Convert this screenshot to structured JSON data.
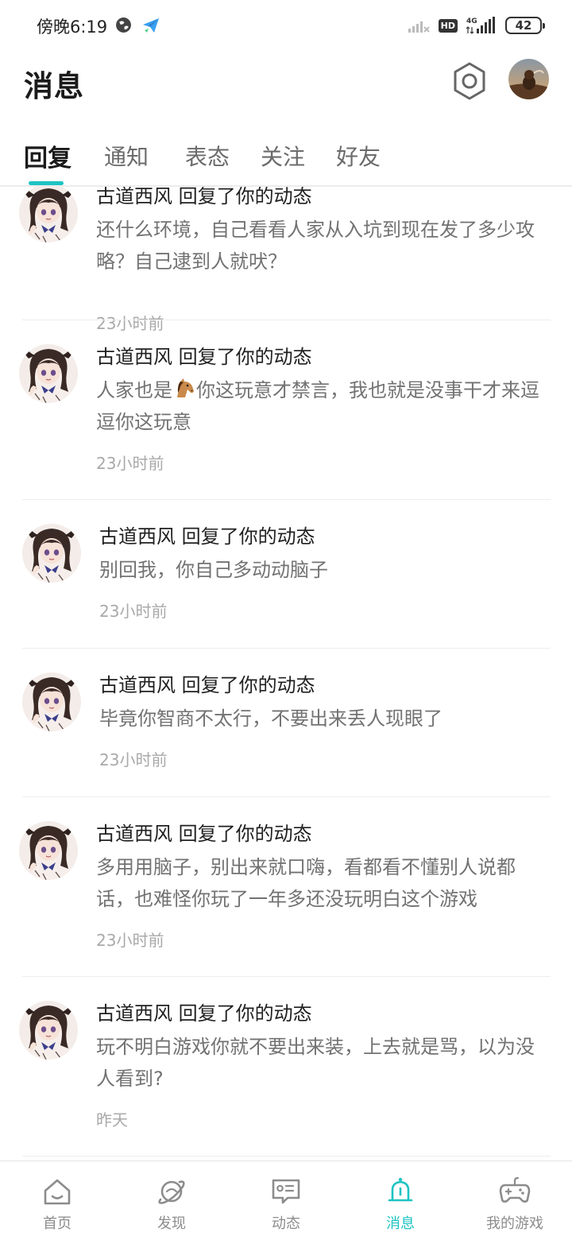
{
  "status_bar": {
    "time": "傍晚6:19",
    "hd_label": "HD",
    "network_label": "4G",
    "battery": "42"
  },
  "header": {
    "title": "消息"
  },
  "tabs": [
    {
      "label": "回复",
      "active": true
    },
    {
      "label": "通知",
      "active": false
    },
    {
      "label": "表态",
      "active": false
    },
    {
      "label": "关注",
      "active": false
    },
    {
      "label": "好友",
      "active": false
    }
  ],
  "messages": [
    {
      "author": "古道西风",
      "action": "回复了你的动态",
      "text": "还什么环境，自己看看人家从入坑到现在发了多少攻略？自己逮到人就吠？",
      "time": "23小时前"
    },
    {
      "author": "古道西风",
      "action": "回复了你的动态",
      "text_before_emoji": "人家也是",
      "emoji": "horse-emoji",
      "text_after_emoji": "你这玩意才禁言，我也就是没事干才来逗逗你这玩意",
      "time": "23小时前"
    },
    {
      "author": "古道西风",
      "action": "回复了你的动态",
      "text": "别回我，你自己多动动脑子",
      "time": "23小时前"
    },
    {
      "author": "古道西风",
      "action": "回复了你的动态",
      "text": "毕竟你智商不太行，不要出来丢人现眼了",
      "time": "23小时前"
    },
    {
      "author": "古道西风",
      "action": "回复了你的动态",
      "text": "多用用脑子，别出来就口嗨，看都看不懂别人说都话，也难怪你玩了一年多还没玩明白这个游戏",
      "time": "23小时前"
    },
    {
      "author": "古道西风",
      "action": "回复了你的动态",
      "text": "玩不明白游戏你就不要出来装，上去就是骂，以为没人看到?",
      "time": "昨天"
    }
  ],
  "bottom_nav": [
    {
      "label": "首页",
      "icon": "home-icon",
      "active": false
    },
    {
      "label": "发现",
      "icon": "planet-icon",
      "active": false
    },
    {
      "label": "动态",
      "icon": "feed-icon",
      "active": false
    },
    {
      "label": "消息",
      "icon": "bell-icon",
      "active": true
    },
    {
      "label": "我的游戏",
      "icon": "gamepad-icon",
      "active": false
    }
  ],
  "colors": {
    "accent": "#1ec3c3",
    "text_primary": "#1f1f1f",
    "text_secondary": "#727272",
    "text_muted": "#a9a9a9"
  }
}
